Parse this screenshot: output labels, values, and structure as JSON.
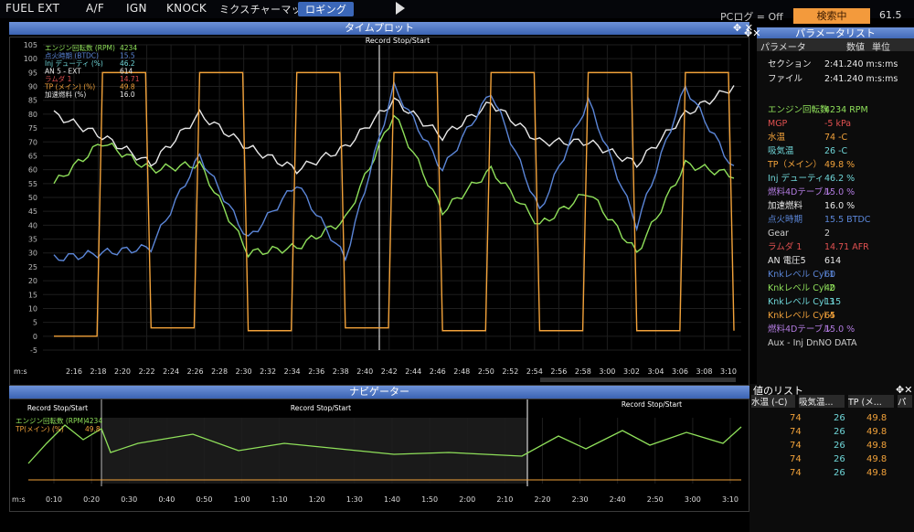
{
  "menu": [
    "FUEL EXT",
    "A/F",
    "IGN",
    "KNOCK",
    "ミクスチャーマップ",
    "ロギング"
  ],
  "pc_log": "PCログ = Off",
  "status": "検索中",
  "pct": "61.5",
  "timeplot": {
    "title": "タイムプロット",
    "record": "Record Stop/Start",
    "y_ticks": [
      "105",
      "100",
      "95",
      "90",
      "85",
      "80",
      "75",
      "70",
      "65",
      "60",
      "55",
      "50",
      "45",
      "40",
      "35",
      "30",
      "25",
      "20",
      "15",
      "10",
      "5",
      "0",
      "-5"
    ],
    "x_unit": "m:s",
    "x_ticks": [
      "2:16",
      "2:18",
      "2:20",
      "2:22",
      "2:24",
      "2:26",
      "2:28",
      "2:30",
      "2:32",
      "2:34",
      "2:36",
      "2:38",
      "2:40",
      "2:42",
      "2:44",
      "2:46",
      "2:48",
      "2:50",
      "2:52",
      "2:54",
      "2:56",
      "2:58",
      "3:00",
      "3:02",
      "3:04",
      "3:06",
      "3:08",
      "3:10"
    ],
    "legend": [
      {
        "label": "エンジン回転数 (RPM)",
        "value": "4234",
        "color": "#8fe05a"
      },
      {
        "label": "点火時期 (BTDC)",
        "value": "15.5",
        "color": "#5b86d8"
      },
      {
        "label": "Inj デューティ (%)",
        "value": "46.2",
        "color": "#6fd6d8"
      },
      {
        "label": "AN 5 - EXT",
        "value": "614",
        "color": "#e8e8e8"
      },
      {
        "label": "ラムダ 1",
        "value": "14.71",
        "color": "#e05050"
      },
      {
        "label": "TP (メイン) (%)",
        "value": "49.8",
        "color": "#f2a23a"
      },
      {
        "label": "加速燃料 (%)",
        "value": "16.0",
        "color": "#e8e8e8"
      }
    ]
  },
  "params": {
    "title": "パラメータリスト",
    "headers": [
      "パラメータ",
      "数値",
      "単位"
    ],
    "rows": [
      {
        "name": "セクション",
        "value": "2:41.240",
        "unit": "m:s:ms",
        "color": "#e8e8e8"
      },
      {
        "name": "ファイル",
        "value": "2:41.240",
        "unit": "m:s:ms",
        "color": "#e8e8e8"
      },
      {
        "name": "エンジン回転数",
        "value": "4234",
        "unit": "RPM",
        "color": "#8fe05a"
      },
      {
        "name": "MGP",
        "value": "-5",
        "unit": "kPa",
        "color": "#e05050"
      },
      {
        "name": "水温",
        "value": "74",
        "unit": "-C",
        "color": "#f2a23a"
      },
      {
        "name": "吸気温",
        "value": "26",
        "unit": "-C",
        "color": "#6fd6d8"
      },
      {
        "name": "TP（メイン）",
        "value": "49.8",
        "unit": "%",
        "color": "#f2a23a"
      },
      {
        "name": "Inj デューティ",
        "value": "46.2",
        "unit": "%",
        "color": "#6fd6d8"
      },
      {
        "name": "燃料4Dテーブル",
        "value": "15.0",
        "unit": "%",
        "color": "#b27be0"
      },
      {
        "name": "加速燃料",
        "value": "16.0",
        "unit": "%",
        "color": "#e8e8e8"
      },
      {
        "name": "点火時期",
        "value": "15.5",
        "unit": "BTDC",
        "color": "#5b86d8"
      },
      {
        "name": "Gear",
        "value": "2",
        "unit": "",
        "color": "#cfcfcf"
      },
      {
        "name": "ラムダ 1",
        "value": "14.71",
        "unit": "AFR",
        "color": "#e05050"
      },
      {
        "name": "AN 電圧5",
        "value": "614",
        "unit": "",
        "color": "#e8e8e8"
      },
      {
        "name": "Knkレベル Cyl 1",
        "value": "60",
        "unit": "",
        "color": "#5b86d8"
      },
      {
        "name": "Knkレベル Cyl 2",
        "value": "40",
        "unit": "",
        "color": "#8fe05a"
      },
      {
        "name": "Knkレベル Cyl 3",
        "value": "115",
        "unit": "",
        "color": "#6fd6d8"
      },
      {
        "name": "Knkレベル Cyl 4",
        "value": "65",
        "unit": "",
        "color": "#f2a23a"
      },
      {
        "name": "燃料4Dテーブル",
        "value": "15.0",
        "unit": "%",
        "color": "#b27be0"
      },
      {
        "name": "Aux - Inj DnNO DATA",
        "value": "",
        "unit": "",
        "color": "#cfcfcf"
      }
    ]
  },
  "navigator": {
    "title": "ナビゲーター",
    "record": "Record Stop/Start",
    "legend": [
      {
        "label": "エンジン回転数 (RPM)",
        "value": "4234",
        "color": "#8fe05a"
      },
      {
        "label": "TP(メイン) (%)",
        "value": "49.8",
        "color": "#f2a23a"
      }
    ],
    "x_unit": "m:s",
    "x_ticks": [
      "0:10",
      "0:20",
      "0:30",
      "0:40",
      "0:50",
      "1:00",
      "1:10",
      "1:20",
      "1:30",
      "1:40",
      "1:50",
      "2:00",
      "2:10",
      "2:20",
      "2:30",
      "2:40",
      "2:50",
      "3:00",
      "3:10"
    ]
  },
  "value_list": {
    "title": "値のリスト",
    "headers": [
      "水温 (-C)",
      "吸気温...",
      "TP (メ...",
      "パ"
    ],
    "rows": [
      [
        "74",
        "26",
        "49.8"
      ],
      [
        "74",
        "26",
        "49.8"
      ],
      [
        "74",
        "26",
        "49.8"
      ],
      [
        "74",
        "26",
        "49.8"
      ],
      [
        "74",
        "26",
        "49.8"
      ]
    ]
  },
  "chart_data": {
    "type": "line",
    "title": "タイムプロット",
    "xlabel": "m:s",
    "ylim": [
      -5,
      105
    ],
    "x": [
      "2:16",
      "2:20",
      "2:24",
      "2:28",
      "2:32",
      "2:36",
      "2:40",
      "2:44",
      "2:48",
      "2:52",
      "2:56",
      "3:00",
      "3:04",
      "3:08",
      "3:10"
    ],
    "series": [
      {
        "name": "エンジン回転数 (RPM)",
        "color": "#8fe05a",
        "values": [
          55,
          70,
          60,
          62,
          30,
          32,
          42,
          80,
          45,
          60,
          40,
          52,
          30,
          62,
          58
        ]
      },
      {
        "name": "AN 5 - EXT",
        "color": "#e8e8e8",
        "values": [
          80,
          72,
          62,
          80,
          68,
          60,
          68,
          85,
          72,
          84,
          70,
          70,
          62,
          80,
          90
        ]
      },
      {
        "name": "点火時期 (BTDC)",
        "color": "#5b86d8",
        "values": [
          28,
          30,
          32,
          65,
          35,
          55,
          28,
          90,
          60,
          88,
          45,
          85,
          40,
          90,
          60
        ]
      },
      {
        "name": "TP (メイン) (%)",
        "color": "#f2a23a",
        "values": [
          0,
          95,
          3,
          95,
          2,
          95,
          3,
          95,
          2,
          95,
          2,
          95,
          2,
          95,
          2
        ]
      }
    ]
  }
}
